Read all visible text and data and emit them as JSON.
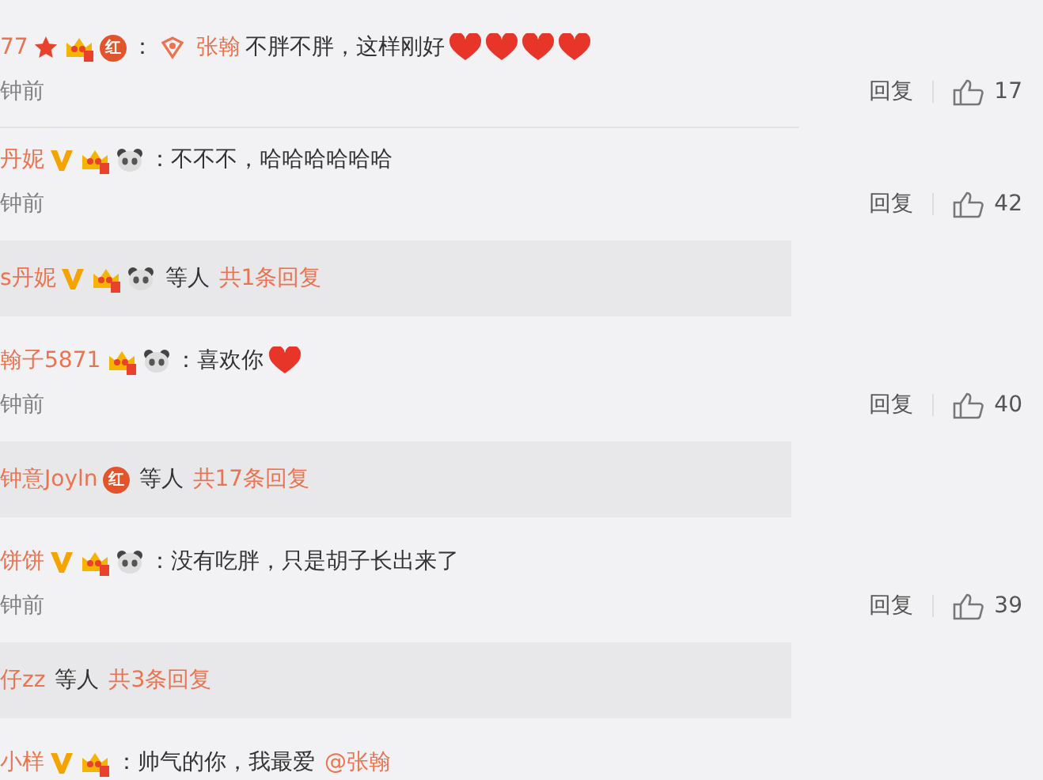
{
  "comments": [
    {
      "name": "77",
      "badges": [
        {
          "kind": "star"
        },
        {
          "kind": "crown"
        },
        {
          "kind": "hong",
          "label": "红"
        }
      ],
      "parts": [
        {
          "kind": "text",
          "text": "："
        },
        {
          "kind": "link-icon"
        },
        {
          "kind": "mention",
          "text": "张翰"
        },
        {
          "kind": "text",
          "text": "不胖不胖，这样刚好"
        },
        {
          "kind": "heart"
        },
        {
          "kind": "heart"
        },
        {
          "kind": "heart"
        },
        {
          "kind": "heart"
        }
      ],
      "time": "钟前",
      "reply": "回复",
      "likes": "17"
    },
    {
      "name": "丹妮",
      "badges": [
        {
          "kind": "v"
        },
        {
          "kind": "crown"
        },
        {
          "kind": "panda"
        }
      ],
      "parts": [
        {
          "kind": "text",
          "text": "：不不不，哈哈哈哈哈哈"
        }
      ],
      "time": "钟前",
      "reply": "回复",
      "likes": "42",
      "replies": {
        "name": "s丹妮",
        "badges": [
          {
            "kind": "v"
          },
          {
            "kind": "crown"
          },
          {
            "kind": "panda"
          }
        ],
        "suffix": "等人",
        "count": "共1条回复"
      }
    },
    {
      "name": "翰子5871",
      "badges": [
        {
          "kind": "crown"
        },
        {
          "kind": "panda"
        }
      ],
      "parts": [
        {
          "kind": "text",
          "text": "：喜欢你"
        },
        {
          "kind": "heart"
        }
      ],
      "time": "钟前",
      "reply": "回复",
      "likes": "40",
      "replies": {
        "name": "钟意Joyln",
        "badges": [
          {
            "kind": "hong",
            "label": "红"
          }
        ],
        "suffix": "等人",
        "count": "共17条回复"
      }
    },
    {
      "name": "饼饼",
      "badges": [
        {
          "kind": "v"
        },
        {
          "kind": "crown"
        },
        {
          "kind": "panda"
        }
      ],
      "parts": [
        {
          "kind": "text",
          "text": "：没有吃胖，只是胡子长出来了"
        }
      ],
      "time": "钟前",
      "reply": "回复",
      "likes": "39",
      "replies": {
        "name": "仔zz",
        "suffix": "等人",
        "count": "共3条回复"
      }
    },
    {
      "name": "小样",
      "badges": [
        {
          "kind": "v"
        },
        {
          "kind": "crown"
        }
      ],
      "parts": [
        {
          "kind": "text",
          "text": "：帅气的你，我最爱"
        },
        {
          "kind": "mention",
          "text": "@张翰"
        }
      ]
    }
  ]
}
